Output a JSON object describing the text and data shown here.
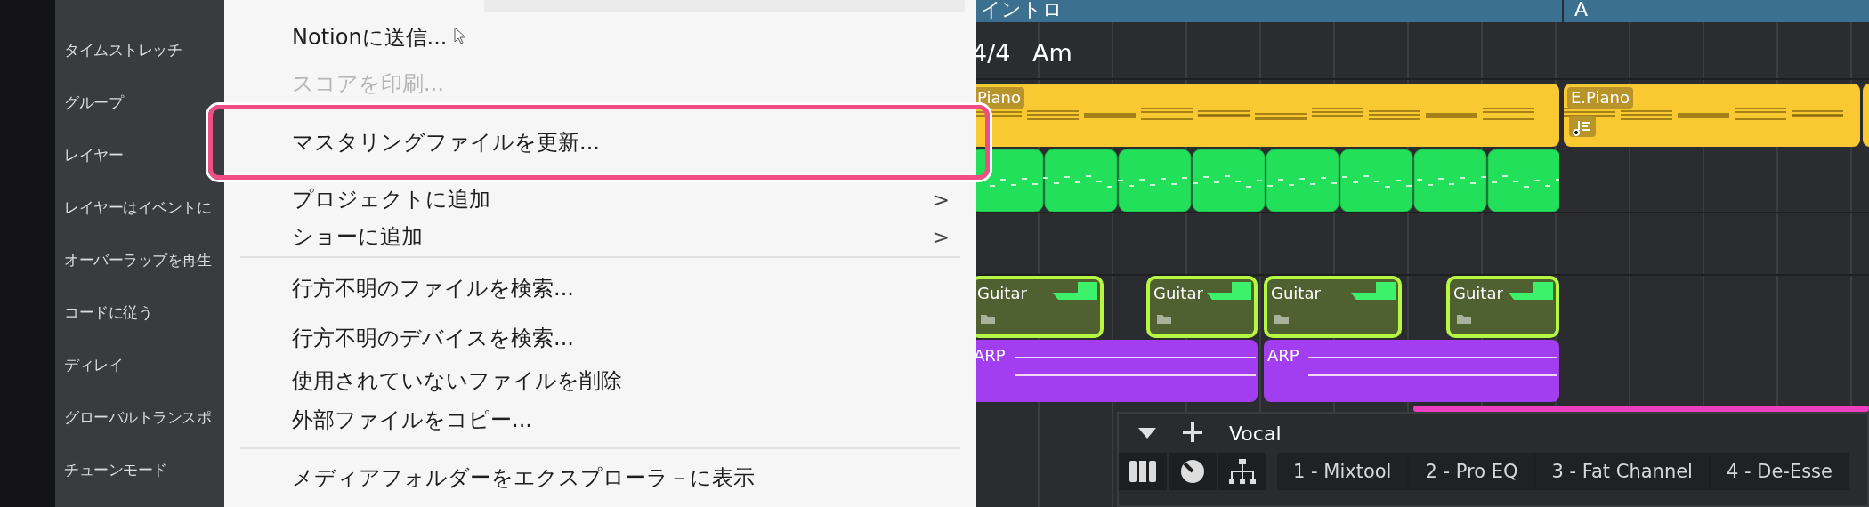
{
  "sidebar": {
    "items": [
      {
        "label": "タイムストレッチ"
      },
      {
        "label": "グループ"
      },
      {
        "label": "レイヤー"
      },
      {
        "label": "レイヤーはイベントに"
      },
      {
        "label": "オーバーラップを再生"
      },
      {
        "label": "コードに従う"
      },
      {
        "label": "ディレイ"
      },
      {
        "label": "グローバルトランスポ"
      },
      {
        "label": "チューンモード"
      }
    ]
  },
  "menu": {
    "items": [
      {
        "kind": "item",
        "label": "Notionに送信...",
        "disabled": false,
        "selected": false
      },
      {
        "kind": "item",
        "label": "スコアを印刷...",
        "disabled": true,
        "selected": false
      },
      {
        "kind": "item",
        "label": "マスタリングファイルを更新...",
        "disabled": false,
        "selected": true
      },
      {
        "kind": "submenu",
        "label": "プロジェクトに追加",
        "arrow": ">",
        "disabled": false,
        "selected": false
      },
      {
        "kind": "submenu",
        "label": "ショーに追加",
        "arrow": ">",
        "disabled": false,
        "selected": false
      },
      {
        "kind": "separator"
      },
      {
        "kind": "item",
        "label": "行方不明のファイルを検索...",
        "disabled": false,
        "selected": false
      },
      {
        "kind": "item",
        "label": "行方不明のデバイスを検索...",
        "disabled": false,
        "selected": false
      },
      {
        "kind": "item",
        "label": "使用されていないファイルを削除",
        "disabled": false,
        "selected": false
      },
      {
        "kind": "item",
        "label": "外部ファイルをコピー...",
        "disabled": false,
        "selected": false
      },
      {
        "kind": "separator"
      },
      {
        "kind": "item",
        "label": "メディアフォルダーをエクスプローラ－に表示",
        "disabled": false,
        "selected": false
      }
    ]
  },
  "arrangement": {
    "markers": [
      {
        "label": "イントロ"
      },
      {
        "label": "A"
      }
    ],
    "signature": "4/4",
    "key": "Am",
    "clips": [
      {
        "kind": "piano",
        "label": "Piano"
      },
      {
        "kind": "piano",
        "label": "E.Piano"
      },
      {
        "kind": "piano"
      },
      {
        "kind": "green"
      },
      {
        "kind": "guitar",
        "label": "Guitar"
      },
      {
        "kind": "guitar",
        "label": "Guitar"
      },
      {
        "kind": "guitar",
        "label": "Guitar"
      },
      {
        "kind": "guitar",
        "label": "Guitar"
      },
      {
        "kind": "arp",
        "label": "ARP"
      },
      {
        "kind": "arp",
        "label": "ARP"
      },
      {
        "kind": "pink"
      }
    ]
  },
  "channel": {
    "name": "Vocal",
    "inserts": [
      "1 - Mixtool",
      "2 - Pro EQ",
      "3 - Fat Channel",
      "4 - De-Esse"
    ]
  }
}
